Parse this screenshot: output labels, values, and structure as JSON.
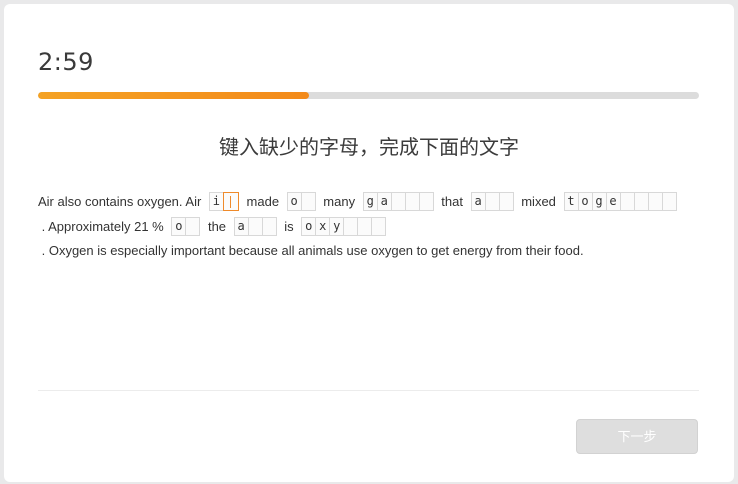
{
  "timer": "2:59",
  "progress": {
    "fraction": 0.41,
    "color": "#f38a1a",
    "track_color": "#dcdcdc"
  },
  "instruction": "键入缺少的字母，完成下面的文字",
  "passage": [
    {
      "t": "text",
      "v": "Air also contains oxygen. Air "
    },
    {
      "t": "gap",
      "name": "gap-is",
      "letters": [
        "i"
      ],
      "blanks": 1,
      "active": true
    },
    {
      "t": "text",
      "v": " made "
    },
    {
      "t": "gap",
      "name": "gap-of",
      "letters": [
        "o"
      ],
      "blanks": 1
    },
    {
      "t": "text",
      "v": " many "
    },
    {
      "t": "gap",
      "name": "gap-gases",
      "letters": [
        "g",
        "a"
      ],
      "blanks": 3
    },
    {
      "t": "text",
      "v": " that "
    },
    {
      "t": "gap",
      "name": "gap-are",
      "letters": [
        "a"
      ],
      "blanks": 2
    },
    {
      "t": "text",
      "v": " mixed "
    },
    {
      "t": "gap",
      "name": "gap-together",
      "letters": [
        "t",
        "o",
        "g",
        "e"
      ],
      "blanks": 4
    },
    {
      "t": "text",
      "v": " . Approximately 21 % "
    },
    {
      "t": "gap",
      "name": "gap-of-2",
      "letters": [
        "o"
      ],
      "blanks": 1
    },
    {
      "t": "text",
      "v": " the "
    },
    {
      "t": "gap",
      "name": "gap-air",
      "letters": [
        "a"
      ],
      "blanks": 2
    },
    {
      "t": "text",
      "v": " is "
    },
    {
      "t": "gap",
      "name": "gap-oxygen",
      "letters": [
        "o",
        "x",
        "y"
      ],
      "blanks": 3
    },
    {
      "t": "text",
      "v": " . Oxygen is especially important because all animals use oxygen to get energy from their food."
    }
  ],
  "next_button": "下一步"
}
